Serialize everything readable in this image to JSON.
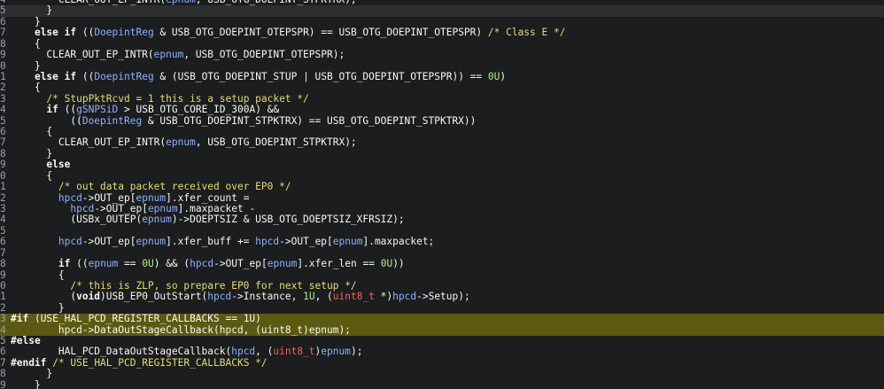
{
  "colors": {
    "background": "#1b1d1e",
    "current_line": "#2c2e30",
    "preprocessor_highlight": "#5c5a12",
    "identifier": "#8fb0ff",
    "comment": "#e6db74",
    "number": "#b8e986",
    "type": "#ff5c57",
    "text": "#f8f8f2"
  },
  "lines": [
    {
      "num": "4",
      "hl": "",
      "tokens": [
        [
          "p",
          "        CLEAR_OUT_EP_INTR("
        ],
        [
          "id",
          "epnum"
        ],
        [
          "p",
          ", USB_OTG_DOEPINT_STPKTRX);"
        ]
      ]
    },
    {
      "num": "5",
      "hl": "cur",
      "tokens": [
        [
          "p",
          "      }"
        ]
      ]
    },
    {
      "num": "6",
      "hl": "",
      "tokens": [
        [
          "p",
          "    }"
        ]
      ]
    },
    {
      "num": "7",
      "hl": "",
      "tokens": [
        [
          "p",
          "    "
        ],
        [
          "kw",
          "else if"
        ],
        [
          "p",
          " (("
        ],
        [
          "id",
          "DoepintReg"
        ],
        [
          "p",
          " & USB_OTG_DOEPINT_OTEPSPR) == USB_OTG_DOEPINT_OTEPSPR) "
        ],
        [
          "com",
          "/* Class E */"
        ]
      ]
    },
    {
      "num": "8",
      "hl": "",
      "tokens": [
        [
          "p",
          "    {"
        ]
      ]
    },
    {
      "num": "9",
      "hl": "",
      "tokens": [
        [
          "p",
          "      CLEAR_OUT_EP_INTR("
        ],
        [
          "id",
          "epnum"
        ],
        [
          "p",
          ", USB_OTG_DOEPINT_OTEPSPR);"
        ]
      ]
    },
    {
      "num": "0",
      "hl": "",
      "tokens": [
        [
          "p",
          "    }"
        ]
      ]
    },
    {
      "num": "1",
      "hl": "",
      "tokens": [
        [
          "p",
          "    "
        ],
        [
          "kw",
          "else if"
        ],
        [
          "p",
          " (("
        ],
        [
          "id",
          "DoepintReg"
        ],
        [
          "p",
          " & (USB_OTG_DOEPINT_STUP | USB_OTG_DOEPINT_OTEPSPR)) == "
        ],
        [
          "num",
          "0U"
        ],
        [
          "p",
          ")"
        ]
      ]
    },
    {
      "num": "2",
      "hl": "",
      "tokens": [
        [
          "p",
          "    {"
        ]
      ]
    },
    {
      "num": "3",
      "hl": "",
      "tokens": [
        [
          "p",
          "      "
        ],
        [
          "com",
          "/* StupPktRcvd = 1 this is a setup packet */"
        ]
      ]
    },
    {
      "num": "4",
      "hl": "",
      "tokens": [
        [
          "p",
          "      "
        ],
        [
          "kw",
          "if"
        ],
        [
          "p",
          " (("
        ],
        [
          "id",
          "gSNPSiD"
        ],
        [
          "p",
          " > USB_OTG_CORE_ID_300A) &&"
        ]
      ]
    },
    {
      "num": "5",
      "hl": "",
      "tokens": [
        [
          "p",
          "          (("
        ],
        [
          "id",
          "DoepintReg"
        ],
        [
          "p",
          " & USB_OTG_DOEPINT_STPKTRX) == USB_OTG_DOEPINT_STPKTRX))"
        ]
      ]
    },
    {
      "num": "6",
      "hl": "",
      "tokens": [
        [
          "p",
          "      {"
        ]
      ]
    },
    {
      "num": "7",
      "hl": "",
      "tokens": [
        [
          "p",
          "        CLEAR_OUT_EP_INTR("
        ],
        [
          "id",
          "epnum"
        ],
        [
          "p",
          ", USB_OTG_DOEPINT_STPKTRX);"
        ]
      ]
    },
    {
      "num": "8",
      "hl": "",
      "tokens": [
        [
          "p",
          "      }"
        ]
      ]
    },
    {
      "num": "9",
      "hl": "",
      "tokens": [
        [
          "p",
          "      "
        ],
        [
          "kw",
          "else"
        ]
      ]
    },
    {
      "num": "0",
      "hl": "",
      "tokens": [
        [
          "p",
          "      {"
        ]
      ]
    },
    {
      "num": "1",
      "hl": "",
      "tokens": [
        [
          "p",
          "        "
        ],
        [
          "com",
          "/* out data packet received over EP0 */"
        ]
      ]
    },
    {
      "num": "2",
      "hl": "",
      "tokens": [
        [
          "p",
          "        "
        ],
        [
          "id",
          "hpcd"
        ],
        [
          "p",
          "->OUT_ep["
        ],
        [
          "id",
          "epnum"
        ],
        [
          "p",
          "].xfer_count ="
        ]
      ]
    },
    {
      "num": "3",
      "hl": "",
      "tokens": [
        [
          "p",
          "          "
        ],
        [
          "id",
          "hpcd"
        ],
        [
          "p",
          "->OUT_ep["
        ],
        [
          "id",
          "epnum"
        ],
        [
          "p",
          "].maxpacket -"
        ]
      ]
    },
    {
      "num": "4",
      "hl": "",
      "tokens": [
        [
          "p",
          "          (USBx_OUTEP("
        ],
        [
          "id",
          "epnum"
        ],
        [
          "p",
          ")->DOEPTSIZ & USB_OTG_DOEPTSIZ_XFRSIZ);"
        ]
      ]
    },
    {
      "num": "5",
      "hl": "",
      "tokens": [
        [
          "p",
          ""
        ]
      ]
    },
    {
      "num": "6",
      "hl": "",
      "tokens": [
        [
          "p",
          "        "
        ],
        [
          "id",
          "hpcd"
        ],
        [
          "p",
          "->OUT_ep["
        ],
        [
          "id",
          "epnum"
        ],
        [
          "p",
          "].xfer_buff += "
        ],
        [
          "id",
          "hpcd"
        ],
        [
          "p",
          "->OUT_ep["
        ],
        [
          "id",
          "epnum"
        ],
        [
          "p",
          "].maxpacket;"
        ]
      ]
    },
    {
      "num": "7",
      "hl": "",
      "tokens": [
        [
          "p",
          ""
        ]
      ]
    },
    {
      "num": "8",
      "hl": "",
      "tokens": [
        [
          "p",
          "        "
        ],
        [
          "kw",
          "if"
        ],
        [
          "p",
          " (("
        ],
        [
          "id",
          "epnum"
        ],
        [
          "p",
          " == "
        ],
        [
          "num",
          "0U"
        ],
        [
          "p",
          ") && ("
        ],
        [
          "id",
          "hpcd"
        ],
        [
          "p",
          "->OUT_ep["
        ],
        [
          "id",
          "epnum"
        ],
        [
          "p",
          "].xfer_len == "
        ],
        [
          "num",
          "0U"
        ],
        [
          "p",
          "))"
        ]
      ]
    },
    {
      "num": "9",
      "hl": "",
      "tokens": [
        [
          "p",
          "        {"
        ]
      ]
    },
    {
      "num": "0",
      "hl": "",
      "tokens": [
        [
          "p",
          "          "
        ],
        [
          "com",
          "/* this is ZLP, so prepare EP0 for next setup */"
        ]
      ]
    },
    {
      "num": "1",
      "hl": "",
      "tokens": [
        [
          "p",
          "          ("
        ],
        [
          "kw",
          "void"
        ],
        [
          "p",
          ")USB_EP0_OutStart("
        ],
        [
          "id",
          "hpcd"
        ],
        [
          "p",
          "->Instance, "
        ],
        [
          "num",
          "1U"
        ],
        [
          "p",
          ", ("
        ],
        [
          "typ",
          "uint8_t"
        ],
        [
          "p",
          " *)"
        ],
        [
          "id",
          "hpcd"
        ],
        [
          "p",
          "->Setup);"
        ]
      ]
    },
    {
      "num": "2",
      "hl": "",
      "tokens": [
        [
          "p",
          "        }"
        ]
      ]
    },
    {
      "num": "3",
      "hl": "pp",
      "tokens": [
        [
          "pp",
          "#if"
        ],
        [
          "p",
          " (USE_HAL_PCD_REGISTER_CALLBACKS == 1U)"
        ]
      ]
    },
    {
      "num": "4",
      "hl": "pp",
      "tokens": [
        [
          "p",
          "        hpcd->DataOutStageCallback(hpcd, (uint8_t)epnum);"
        ]
      ]
    },
    {
      "num": "5",
      "hl": "",
      "tokens": [
        [
          "pp",
          "#else"
        ]
      ]
    },
    {
      "num": "6",
      "hl": "",
      "tokens": [
        [
          "p",
          "        HAL_PCD_DataOutStageCallback("
        ],
        [
          "id",
          "hpcd"
        ],
        [
          "p",
          ", ("
        ],
        [
          "typ",
          "uint8_t"
        ],
        [
          "p",
          ")"
        ],
        [
          "id",
          "epnum"
        ],
        [
          "p",
          ");"
        ]
      ]
    },
    {
      "num": "7",
      "hl": "",
      "tokens": [
        [
          "pp",
          "#endif"
        ],
        [
          "p",
          " "
        ],
        [
          "com",
          "/* USE_HAL_PCD_REGISTER_CALLBACKS */"
        ]
      ]
    },
    {
      "num": "8",
      "hl": "",
      "tokens": [
        [
          "p",
          "      }"
        ]
      ]
    },
    {
      "num": "9",
      "hl": "",
      "tokens": [
        [
          "p",
          "    }"
        ]
      ]
    }
  ]
}
